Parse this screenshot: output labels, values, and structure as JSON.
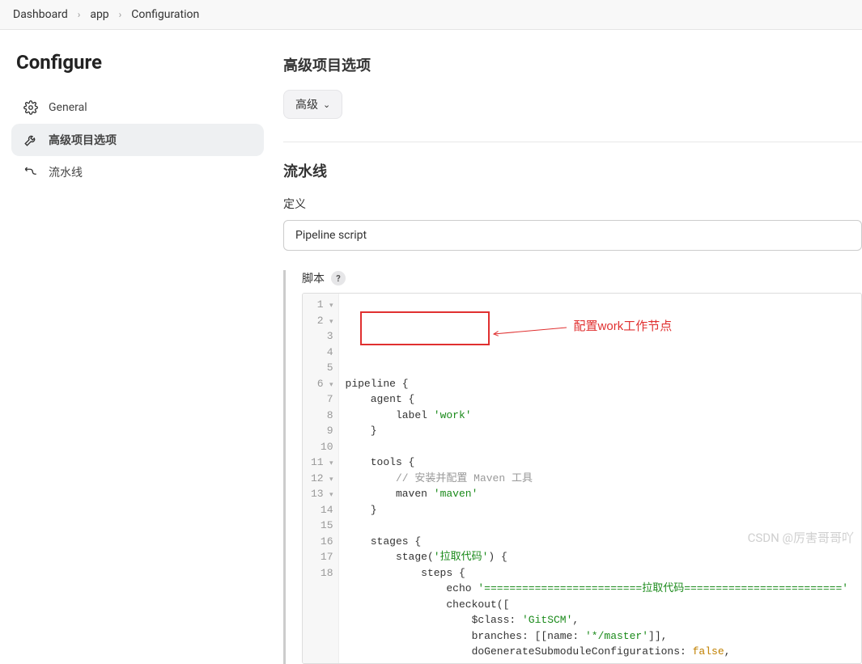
{
  "breadcrumb": {
    "items": [
      "Dashboard",
      "app",
      "Configuration"
    ]
  },
  "page_title": "Configure",
  "sidebar": {
    "items": [
      {
        "label": "General",
        "icon": "gear"
      },
      {
        "label": "高级项目选项",
        "icon": "wrench"
      },
      {
        "label": "流水线",
        "icon": "pipeline"
      }
    ]
  },
  "sections": {
    "advanced": {
      "title": "高级项目选项",
      "button": "高级"
    },
    "pipeline": {
      "title": "流水线",
      "definition_label": "定义",
      "definition_value": "Pipeline script",
      "script_label": "脚本"
    }
  },
  "annotation": {
    "text": "配置work工作节点"
  },
  "code": {
    "lines": [
      {
        "n": 1,
        "fold": true,
        "text": "pipeline {"
      },
      {
        "n": 2,
        "fold": true,
        "indent": 1,
        "segs": [
          {
            "t": "agent {"
          }
        ]
      },
      {
        "n": 3,
        "indent": 2,
        "segs": [
          {
            "t": "label "
          },
          {
            "t": "'work'",
            "c": "str"
          }
        ]
      },
      {
        "n": 4,
        "indent": 1,
        "segs": [
          {
            "t": "}"
          }
        ]
      },
      {
        "n": 5,
        "blank": true
      },
      {
        "n": 6,
        "fold": true,
        "indent": 1,
        "segs": [
          {
            "t": "tools {"
          }
        ]
      },
      {
        "n": 7,
        "indent": 2,
        "segs": [
          {
            "t": "// 安装并配置 Maven 工具",
            "c": "cmt"
          }
        ]
      },
      {
        "n": 8,
        "indent": 2,
        "segs": [
          {
            "t": "maven "
          },
          {
            "t": "'maven'",
            "c": "str"
          }
        ]
      },
      {
        "n": 9,
        "indent": 1,
        "segs": [
          {
            "t": "}"
          }
        ]
      },
      {
        "n": 10,
        "blank": true
      },
      {
        "n": 11,
        "fold": true,
        "indent": 1,
        "segs": [
          {
            "t": "stages {"
          }
        ]
      },
      {
        "n": 12,
        "fold": true,
        "indent": 2,
        "segs": [
          {
            "t": "stage("
          },
          {
            "t": "'拉取代码'",
            "c": "str"
          },
          {
            "t": ") {"
          }
        ]
      },
      {
        "n": 13,
        "fold": true,
        "indent": 3,
        "segs": [
          {
            "t": "steps {"
          }
        ]
      },
      {
        "n": 14,
        "indent": 4,
        "segs": [
          {
            "t": "echo "
          },
          {
            "t": "'=========================拉取代码========================='",
            "c": "str"
          }
        ]
      },
      {
        "n": 15,
        "indent": 4,
        "segs": [
          {
            "t": "checkout(["
          }
        ]
      },
      {
        "n": 16,
        "indent": 5,
        "segs": [
          {
            "t": "$class: "
          },
          {
            "t": "'GitSCM'",
            "c": "str"
          },
          {
            "t": ","
          }
        ]
      },
      {
        "n": 17,
        "indent": 5,
        "segs": [
          {
            "t": "branches: [[name: "
          },
          {
            "t": "'*/master'",
            "c": "str"
          },
          {
            "t": "]],"
          }
        ]
      },
      {
        "n": 18,
        "indent": 5,
        "segs": [
          {
            "t": "doGenerateSubmoduleConfigurations: "
          },
          {
            "t": "false",
            "c": "bool"
          },
          {
            "t": ","
          }
        ]
      }
    ]
  },
  "watermark": "CSDN @厉害哥哥吖"
}
